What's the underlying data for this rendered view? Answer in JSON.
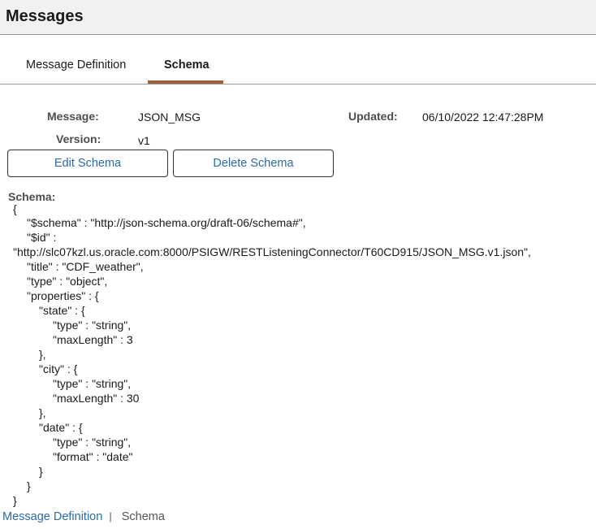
{
  "header": {
    "title": "Messages"
  },
  "tabs": [
    {
      "label": "Message Definition",
      "active": false
    },
    {
      "label": "Schema",
      "active": true
    }
  ],
  "details": {
    "message_label": "Message:",
    "message_value": "JSON_MSG",
    "updated_label": "Updated:",
    "updated_value": "06/10/2022 12:47:28PM",
    "version_label": "Version:",
    "version_value": "v1"
  },
  "buttons": {
    "edit_schema": "Edit Schema",
    "delete_schema": "Delete Schema"
  },
  "schema": {
    "label": "Schema:",
    "lines": [
      "{",
      "\"$schema\" : \"http://json-schema.org/draft-06/schema#\",",
      "\"$id\" :",
      "\"http://slc07kzl.us.oracle.com:8000/PSIGW/RESTListeningConnector/T60CD915/JSON_MSG.v1.json\",",
      "\"title\" : \"CDF_weather\",",
      "\"type\" : \"object\",",
      "\"properties\" : {",
      "\"state\" : {",
      "\"type\" : \"string\",",
      "\"maxLength\" : 3",
      "},",
      "\"city\" : {",
      "\"type\" : \"string\",",
      "\"maxLength\" : 30",
      "},",
      "\"date\" : {",
      "\"type\" : \"string\",",
      "\"format\" : \"date\"",
      "}",
      "}",
      "}"
    ]
  },
  "footer": {
    "link_message_definition": "Message Definition",
    "separator": "|",
    "current": "Schema"
  },
  "colors": {
    "accent": "#a0613c",
    "link": "#2b6aa8"
  }
}
